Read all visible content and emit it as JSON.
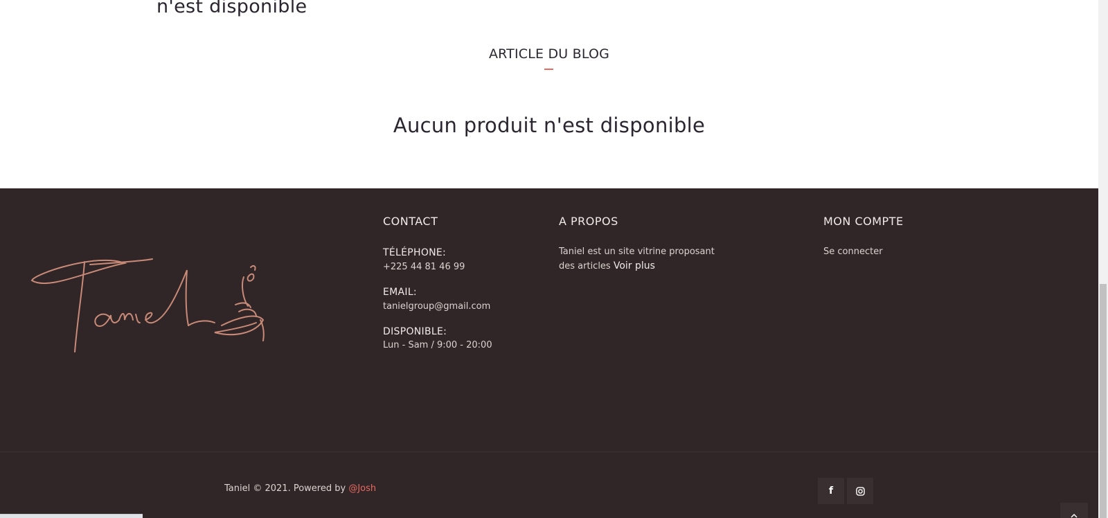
{
  "main": {
    "partial_message": "n'est disponible",
    "blog_section_title": "ARTICLE DU BLOG",
    "empty_message": "Aucun produit n'est disponible"
  },
  "footer": {
    "contact": {
      "title": "CONTACT",
      "phone_label": "TÉLÉPHONE:",
      "phone_value": "+225 44 81 46 99",
      "email_label": "EMAIL:",
      "email_value": "tanielgroup@gmail.com",
      "hours_label": "DISPONIBLE:",
      "hours_value": "Lun - Sam / 9:00 - 20:00"
    },
    "about": {
      "title": "A PROPOS",
      "text_line1": "Taniel est un site vitrine proposant",
      "text_line2": "des articles",
      "more_link": "Voir plus"
    },
    "account": {
      "title": "MON COMPTE",
      "login_link": "Se connecter"
    },
    "copyright": {
      "text": "Taniel © 2021. Powered by",
      "author": "@Josh"
    },
    "social": {
      "facebook_glyph": "f",
      "instagram_icon": "instagram-icon"
    },
    "logo_text": "Taniel"
  },
  "colors": {
    "footer_bg": "#302627",
    "accent": "#e8695f",
    "logo": "#c98a78",
    "heading_text": "#2b2530"
  }
}
